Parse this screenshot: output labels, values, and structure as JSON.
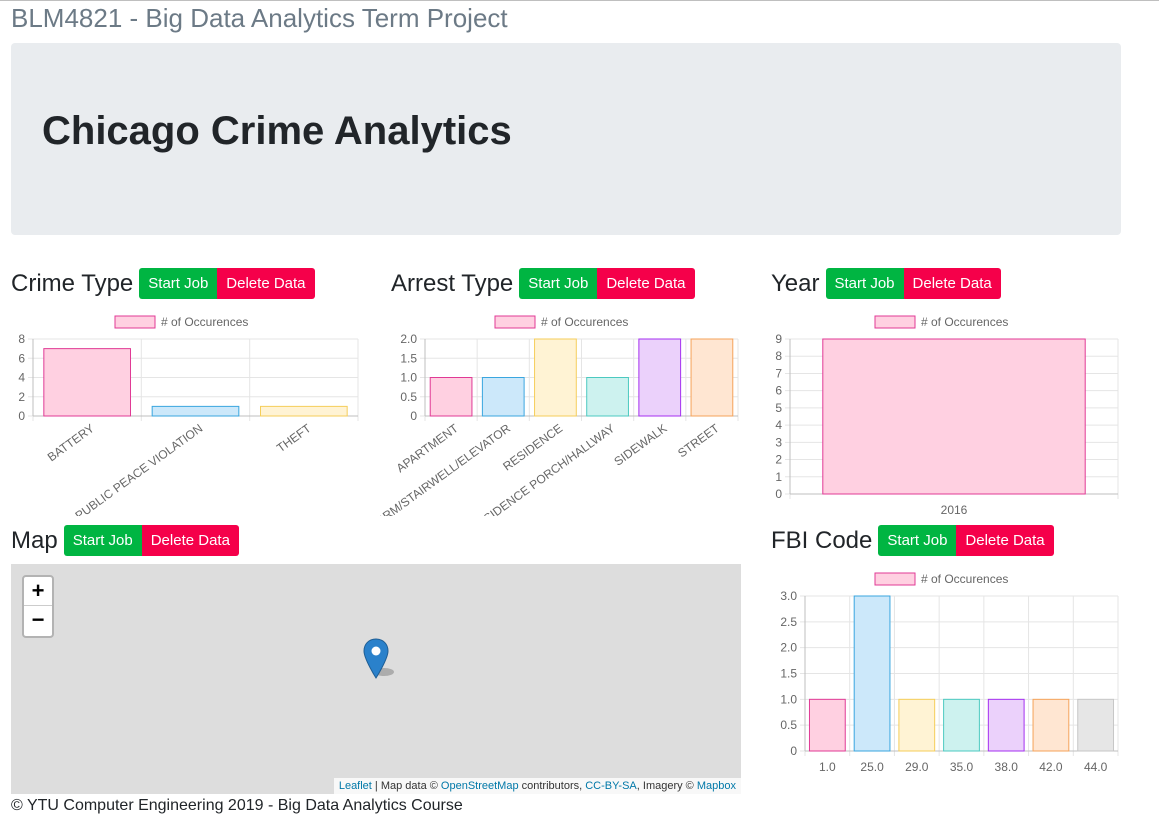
{
  "page": {
    "title": "BLM4821 - Big Data Analytics Term Project",
    "heading": "Chicago Crime Analytics",
    "footer": "© YTU Computer Engineering 2019 - Big Data Analytics Course"
  },
  "buttons": {
    "start": "Start Job",
    "delete": "Delete Data"
  },
  "colors": {
    "start_button": "#00b542",
    "delete_button": "#f5004a",
    "jumbotron": "#e9ecef"
  },
  "sections": {
    "crime_type": {
      "title": "Crime Type"
    },
    "arrest_type": {
      "title": "Arrest Type"
    },
    "year": {
      "title": "Year"
    },
    "map": {
      "title": "Map"
    },
    "fbi_code": {
      "title": "FBI Code"
    }
  },
  "map": {
    "zoom_in": "+",
    "zoom_out": "−",
    "attribution": {
      "leaflet": "Leaflet",
      "sep1": " | Map data © ",
      "osm": "OpenStreetMap",
      "contributors": " contributors, ",
      "license": "CC-BY-SA",
      "imagery": ", Imagery © ",
      "mapbox": "Mapbox"
    }
  },
  "chart_data": [
    {
      "id": "crime_type",
      "type": "bar",
      "legend": "# of Occurences",
      "categories": [
        "BATTERY",
        "PUBLIC PEACE VIOLATION",
        "THEFT"
      ],
      "values": [
        7,
        1,
        1
      ],
      "ylim": [
        0,
        8
      ],
      "yticks": [
        "0",
        "2",
        "4",
        "6",
        "8"
      ],
      "grid": true
    },
    {
      "id": "arrest_type",
      "type": "bar",
      "legend": "# of Occurences",
      "categories": [
        "APARTMENT",
        "CTA \"L\" PLATFORM/STAIRWELL/ELEVATOR",
        "RESIDENCE",
        "RESIDENCE PORCH/HALLWAY",
        "SIDEWALK",
        "STREET"
      ],
      "values": [
        1,
        1,
        2,
        1,
        2,
        2
      ],
      "ylim": [
        0,
        2
      ],
      "yticks": [
        "0",
        "0.5",
        "1.0",
        "1.5",
        "2.0"
      ],
      "grid": true
    },
    {
      "id": "year",
      "type": "bar",
      "legend": "# of Occurences",
      "categories": [
        "2016"
      ],
      "values": [
        9
      ],
      "ylim": [
        0,
        9
      ],
      "yticks": [
        "0",
        "1",
        "2",
        "3",
        "4",
        "5",
        "6",
        "7",
        "8",
        "9"
      ],
      "grid": true
    },
    {
      "id": "fbi_code",
      "type": "bar",
      "legend": "# of Occurences",
      "categories": [
        "1.0",
        "25.0",
        "29.0",
        "35.0",
        "38.0",
        "42.0",
        "44.0"
      ],
      "values": [
        1,
        3,
        1,
        1,
        1,
        1,
        1
      ],
      "ylim": [
        0,
        3
      ],
      "yticks": [
        "0",
        "0.5",
        "1.0",
        "1.5",
        "2.0",
        "2.5",
        "3.0"
      ],
      "grid": true
    }
  ],
  "palette": [
    {
      "fill": "#ffd0e1",
      "stroke": "#e03a95"
    },
    {
      "fill": "#cce8fa",
      "stroke": "#3aa6df"
    },
    {
      "fill": "#fff3d4",
      "stroke": "#f5ce5a"
    },
    {
      "fill": "#cdf2ef",
      "stroke": "#4cc9c0"
    },
    {
      "fill": "#ebd1fb",
      "stroke": "#a42ff0"
    },
    {
      "fill": "#ffe6d2",
      "stroke": "#f5a35a"
    },
    {
      "fill": "#e6e6e6",
      "stroke": "#c6c6c6"
    }
  ]
}
